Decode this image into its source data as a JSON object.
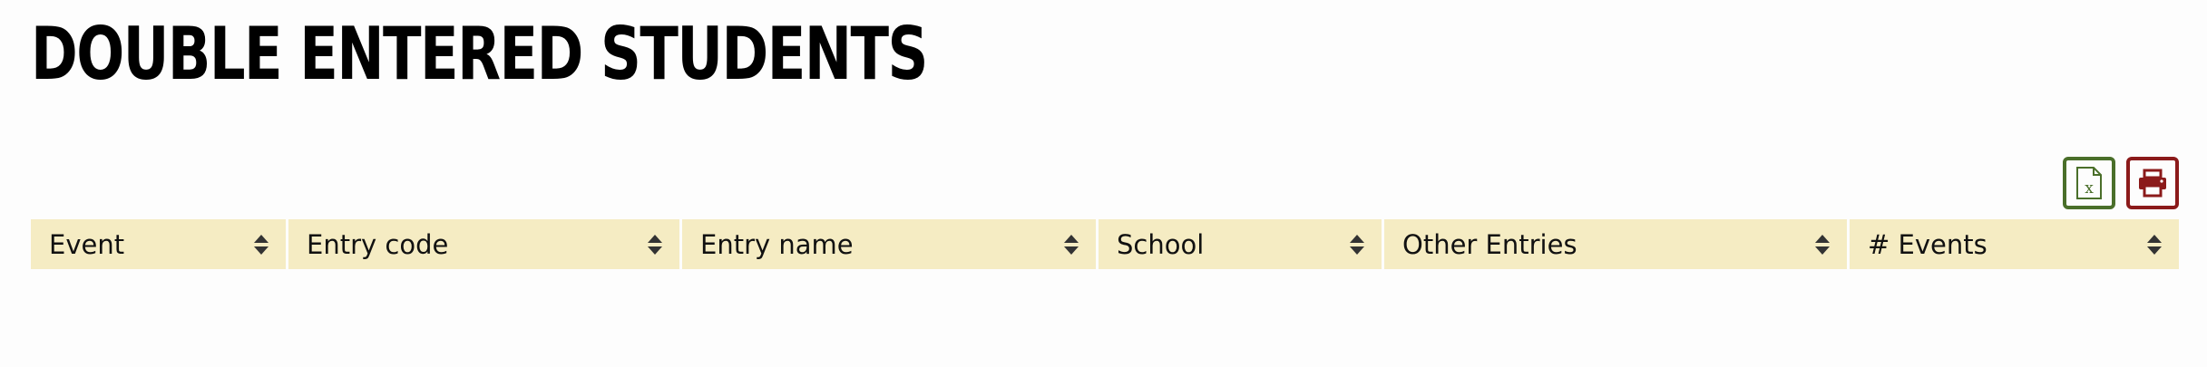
{
  "page": {
    "title": "DOUBLE ENTERED STUDENTS"
  },
  "toolbar": {
    "excel_icon": "excel-file-icon",
    "print_icon": "printer-icon",
    "excel_color": "#4a6f2a",
    "print_color": "#8b1a1a"
  },
  "table": {
    "header_bg": "#f5ecc3",
    "columns": [
      {
        "label": "Event"
      },
      {
        "label": "Entry code"
      },
      {
        "label": "Entry name"
      },
      {
        "label": "School"
      },
      {
        "label": "Other Entries"
      },
      {
        "label": "# Events"
      }
    ],
    "rows": []
  }
}
